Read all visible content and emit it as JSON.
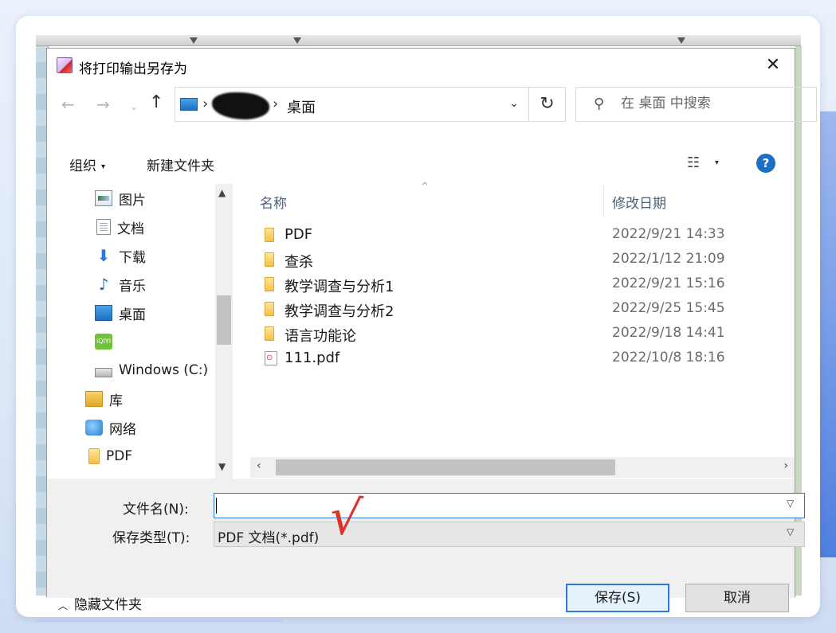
{
  "dialog": {
    "title": "将打印输出另存为",
    "close_label": "✕"
  },
  "nav": {
    "back": "←",
    "forward": "→",
    "recent": "⌄",
    "up": "↑"
  },
  "address": {
    "separator": "›",
    "current": "桌面",
    "dropdown": "⌄",
    "refresh": "↻"
  },
  "search": {
    "placeholder": "在 桌面 中搜索",
    "icon": "⚲"
  },
  "toolbar": {
    "organize": "组织",
    "organize_caret": "▾",
    "new_folder": "新建文件夹",
    "view_icon": "☷",
    "view_caret": "▾",
    "help": "?"
  },
  "sidebar": {
    "items": [
      {
        "label": "图片",
        "icon": "pictures-icon"
      },
      {
        "label": "文档",
        "icon": "documents-icon"
      },
      {
        "label": "下载",
        "icon": "download-icon",
        "glyph": "⬇"
      },
      {
        "label": "音乐",
        "icon": "music-icon",
        "glyph": "♪"
      },
      {
        "label": "桌面",
        "icon": "desktop-icon"
      },
      {
        "label": "",
        "icon": "iqiyi-icon",
        "glyph": "iQIYI"
      },
      {
        "label": "Windows  (C:)",
        "icon": "drive-icon"
      },
      {
        "label": "库",
        "icon": "library-icon"
      },
      {
        "label": "网络",
        "icon": "network-icon"
      },
      {
        "label": "PDF",
        "icon": "folder-icon"
      }
    ]
  },
  "columns": {
    "name": "名称",
    "date": "修改日期",
    "sort_indicator": "^"
  },
  "files": [
    {
      "name": "PDF",
      "date": "2022/9/21 14:33",
      "type": "folder"
    },
    {
      "name": "查杀",
      "date": "2022/1/12 21:09",
      "type": "folder"
    },
    {
      "name": "教学调查与分析1",
      "date": "2022/9/21 15:16",
      "type": "folder"
    },
    {
      "name": "教学调查与分析2",
      "date": "2022/9/25 15:45",
      "type": "folder"
    },
    {
      "name": "语言功能论",
      "date": "2022/9/18 14:41",
      "type": "folder"
    },
    {
      "name": "111.pdf",
      "date": "2022/10/8 18:16",
      "type": "pdf"
    }
  ],
  "form": {
    "filename_label": "文件名(N):",
    "filename_value": "",
    "filetype_label": "保存类型(T):",
    "filetype_value": "PDF 文档(*.pdf)",
    "checkmark": "√",
    "hide_folders": "隐藏文件夹",
    "hide_chevron": "︿",
    "save": "保存(S)",
    "cancel": "取消"
  },
  "colors": {
    "accent": "#2b79d8",
    "annotation": "#e0302a",
    "help": "#1e6fc2"
  }
}
